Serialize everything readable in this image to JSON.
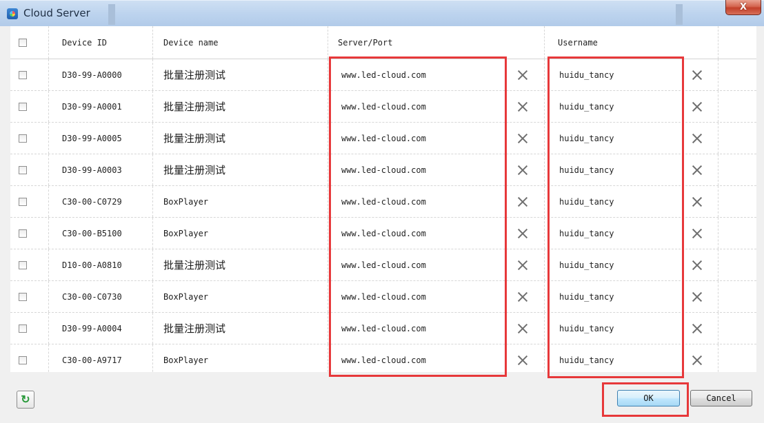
{
  "window": {
    "title": "Cloud Server",
    "close_label": "X"
  },
  "table": {
    "headers": {
      "device_id": "Device ID",
      "device_name": "Device name",
      "server_port": "Server/Port",
      "username": "Username"
    },
    "rows": [
      {
        "device_id": "D30-99-A0000",
        "device_name": "批量注册测试",
        "server": "www.led-cloud.com",
        "username": "huidu_tancy"
      },
      {
        "device_id": "D30-99-A0001",
        "device_name": "批量注册测试",
        "server": "www.led-cloud.com",
        "username": "huidu_tancy"
      },
      {
        "device_id": "D30-99-A0005",
        "device_name": "批量注册测试",
        "server": "www.led-cloud.com",
        "username": "huidu_tancy"
      },
      {
        "device_id": "D30-99-A0003",
        "device_name": "批量注册测试",
        "server": "www.led-cloud.com",
        "username": "huidu_tancy"
      },
      {
        "device_id": "C30-00-C0729",
        "device_name": "BoxPlayer",
        "server": "www.led-cloud.com",
        "username": "huidu_tancy"
      },
      {
        "device_id": "C30-00-B5100",
        "device_name": "BoxPlayer",
        "server": "www.led-cloud.com",
        "username": "huidu_tancy"
      },
      {
        "device_id": "D10-00-A0810",
        "device_name": "批量注册测试",
        "server": "www.led-cloud.com",
        "username": "huidu_tancy"
      },
      {
        "device_id": "C30-00-C0730",
        "device_name": "BoxPlayer",
        "server": "www.led-cloud.com",
        "username": "huidu_tancy"
      },
      {
        "device_id": "D30-99-A0004",
        "device_name": "批量注册测试",
        "server": "www.led-cloud.com",
        "username": "huidu_tancy"
      },
      {
        "device_id": "C30-00-A9717",
        "device_name": "BoxPlayer",
        "server": "www.led-cloud.com",
        "username": "huidu_tancy"
      }
    ]
  },
  "footer": {
    "refresh_icon": "↻",
    "ok_label": "OK",
    "cancel_label": "Cancel"
  },
  "colors": {
    "highlight": "#e7383a",
    "titlebar": "#bcd3ee",
    "ok_button": "#bee6fd"
  },
  "icons": {
    "app": "cloud-server-app-icon",
    "clear": "x-clear-icon",
    "refresh": "refresh-icon",
    "close": "close-icon"
  }
}
